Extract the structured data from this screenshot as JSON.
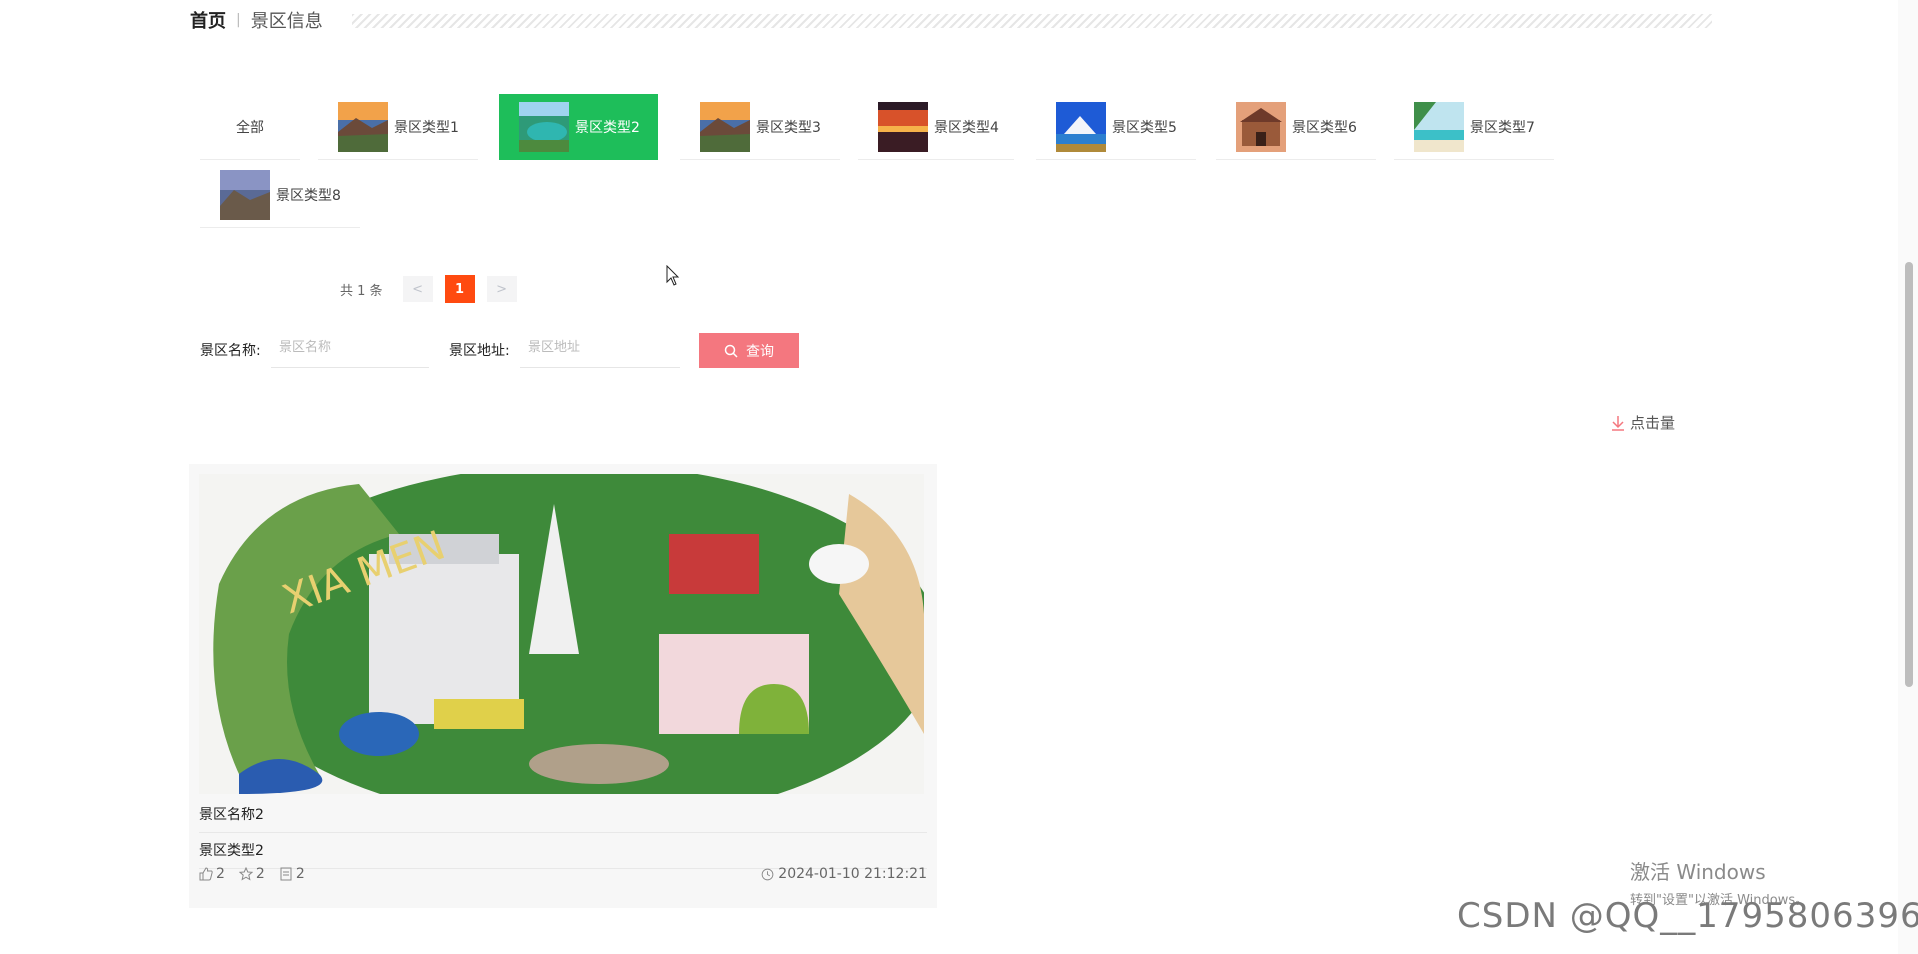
{
  "breadcrumb": {
    "home": "首页",
    "separator": "|",
    "current": "景区信息"
  },
  "categories": [
    {
      "label": "全部"
    },
    {
      "label": "景区类型1"
    },
    {
      "label": "景区类型2"
    },
    {
      "label": "景区类型3"
    },
    {
      "label": "景区类型4"
    },
    {
      "label": "景区类型5"
    },
    {
      "label": "景区类型6"
    },
    {
      "label": "景区类型7"
    },
    {
      "label": "景区类型8"
    }
  ],
  "active_category": "景区类型2",
  "pagination": {
    "total_text": "共 1 条",
    "prev": "<",
    "current_page": "1",
    "next": ">"
  },
  "search": {
    "name_label": "景区名称:",
    "name_placeholder": "景区名称",
    "name_value": "",
    "address_label": "景区地址:",
    "address_placeholder": "景区地址",
    "address_value": "",
    "button_label": "查询"
  },
  "sort": {
    "label": "点击量",
    "icon": "download-arrow-icon"
  },
  "card": {
    "name": "景区名称2",
    "type": "景区类型2",
    "likes": "2",
    "favorites": "2",
    "comments": "2",
    "time": "2024-01-10 21:12:21"
  },
  "watermark": {
    "windows_title": "激活 Windows",
    "windows_sub": "转到\"设置\"以激活 Windows。",
    "csdn": "CSDN @QQ__1795806396"
  },
  "colors": {
    "active_tab": "#1ebe5a",
    "page_active": "#ff4a10",
    "query_button": "#f4777f",
    "sort_icon": "#f4777f"
  }
}
